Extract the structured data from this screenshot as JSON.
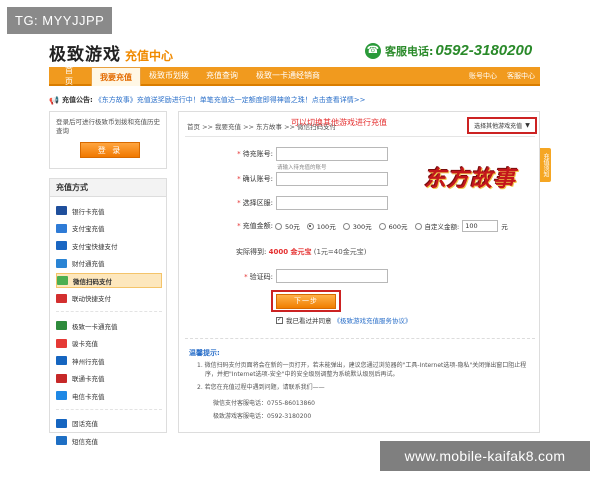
{
  "watermark": {
    "top_left": "TG: MYYJJPP",
    "bottom_right": "www.mobile-kaifak8.com"
  },
  "header": {
    "logo_main": "极致游戏",
    "logo_sub": "充值中心",
    "hotline_label": "客服电话:",
    "hotline_number": "0592-3180200"
  },
  "nav": {
    "items": [
      {
        "label": "首 页"
      },
      {
        "label": "我要充值"
      },
      {
        "label": "极致币划拨"
      },
      {
        "label": "充值查询"
      },
      {
        "label": "极致一卡通经销商"
      }
    ],
    "right_items": [
      {
        "label": "账号中心"
      },
      {
        "label": "客服中心"
      }
    ]
  },
  "notice": {
    "label": "充值公告:",
    "text": "《东方故事》充值送奖励进行中！单笔充值达一定额度即得神兽之珠！点击查看详情>>"
  },
  "login": {
    "tip": "登录后可进行极致币划拨和充值历史查询",
    "button": "登 录"
  },
  "payment": {
    "title": "充值方式",
    "groups": [
      [
        {
          "label": "银行卡充值",
          "icon": "bank-card-icon",
          "color": "#1f4f9c"
        },
        {
          "label": "支付宝充值",
          "icon": "alipay-icon",
          "color": "#2e7bd6"
        },
        {
          "label": "支付宝快捷支付",
          "icon": "alipay-quick-icon",
          "color": "#1a66c2"
        },
        {
          "label": "财付通充值",
          "icon": "tenpay-icon",
          "color": "#2a84d4"
        },
        {
          "label": "微信扫码支付",
          "icon": "wechat-icon",
          "color": "#4caf50",
          "active": true
        },
        {
          "label": "联动快捷支付",
          "icon": "umpay-icon",
          "color": "#d32f2f"
        }
      ],
      [
        {
          "label": "极致一卡通充值",
          "icon": "jizhi-card-icon",
          "color": "#2e8b3c"
        },
        {
          "label": "骏卡充值",
          "icon": "junka-icon",
          "color": "#e53935"
        },
        {
          "label": "神州行充值",
          "icon": "china-mobile-icon",
          "color": "#1565c0"
        },
        {
          "label": "联通卡充值",
          "icon": "unicom-icon",
          "color": "#c62828"
        },
        {
          "label": "电信卡充值",
          "icon": "telecom-icon",
          "color": "#1e88e5"
        }
      ],
      [
        {
          "label": "固话充值",
          "icon": "landline-icon",
          "color": "#1565c0"
        },
        {
          "label": "短信充值",
          "icon": "sms-icon",
          "color": "#1e6fc4"
        }
      ]
    ]
  },
  "main": {
    "breadcrumb": "首页 >> 我要充值 >> 东方故事 >> 微信扫码支付",
    "switch_tip": "可以切换其他游戏进行充值",
    "switch_button": "选择其他游戏充值",
    "game_logo": "东方故事",
    "fields": {
      "account_label": "待充账号:",
      "account_hint": "请输入待充值的账号",
      "confirm_label": "确认账号:",
      "server_label": "选择区服:",
      "amount_label": "充值金额:",
      "actual_label": "实际得到:",
      "actual_value": "4000 金元宝",
      "actual_note": "(1元=40金元宝)",
      "captcha_label": "验证码:"
    },
    "amounts": [
      {
        "label": "50元",
        "checked": false
      },
      {
        "label": "100元",
        "checked": true
      },
      {
        "label": "300元",
        "checked": false
      },
      {
        "label": "600元",
        "checked": false
      }
    ],
    "custom_amount_label": "自定义金额:",
    "custom_amount_value": "100",
    "custom_amount_unit": "元",
    "next_button": "下一步",
    "agree_prefix": "我已看过并同意",
    "agree_link": "《极致游戏充值服务协议》"
  },
  "tips": {
    "title": "温馨提示:",
    "item1_l1": "1. 微信扫码支付页面将会在新的一页打开，若未能弹出，建议您通过浏览器的\"工具-Internet选项-隐私\"关闭弹出窗口阻止程",
    "item1_l2": "序，并把\"Internet选项-安全\"中的安全级别调整为系统默认级别后再试。",
    "item2": "2. 若您在充值过程中遇到问题，请联系我们——",
    "phone1": "微信支付客服电话：0755-86013860",
    "phone2": "极致游戏客服电话：0592-3180200"
  },
  "side_tab": "充值须知"
}
